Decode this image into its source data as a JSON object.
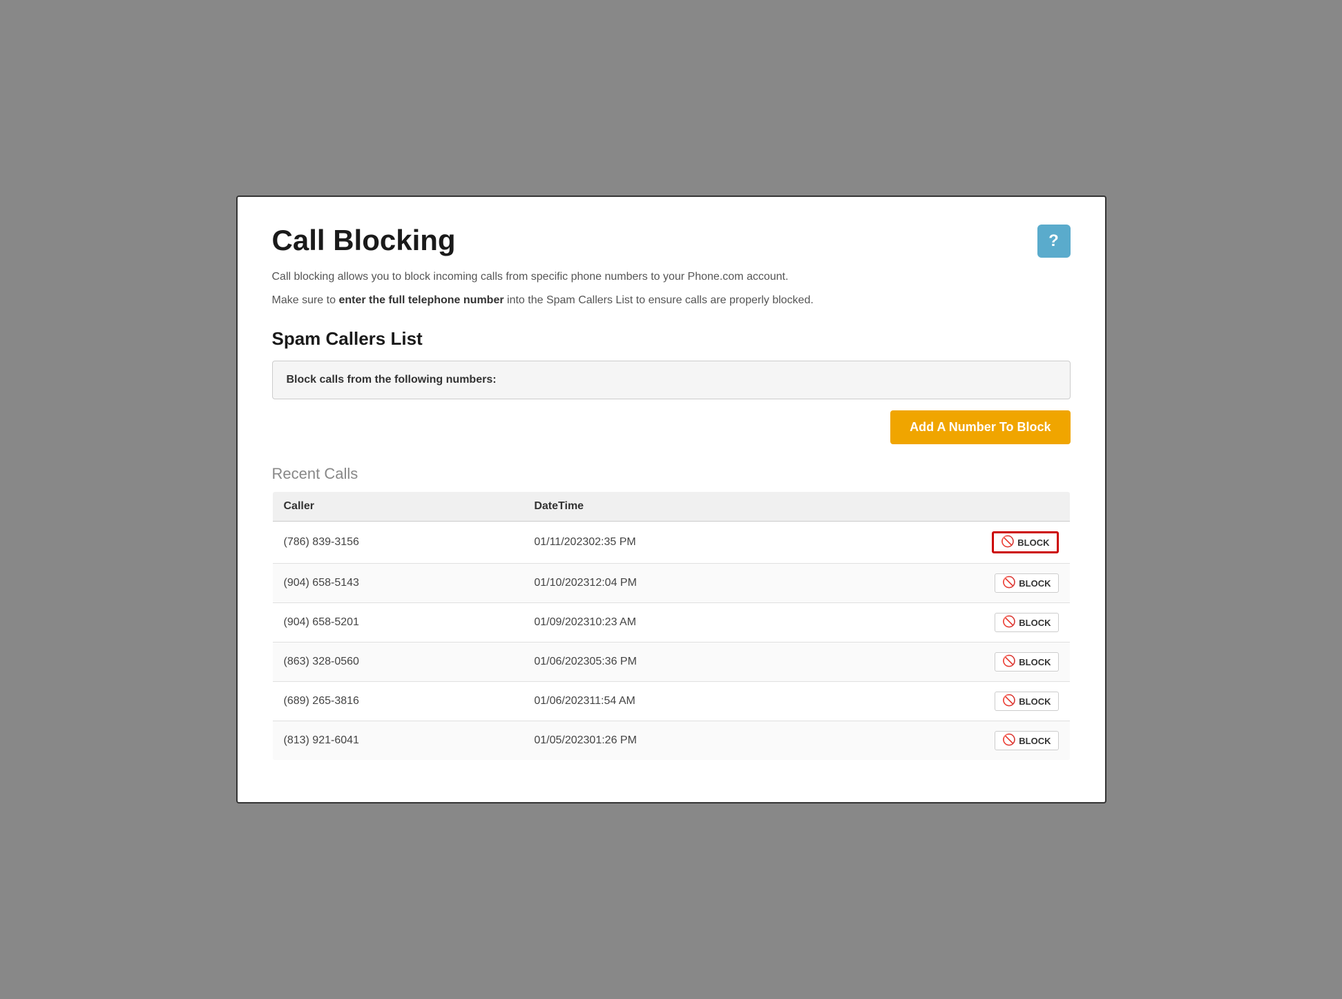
{
  "page": {
    "title": "Call Blocking",
    "help_button_label": "?",
    "description1": "Call blocking allows you to block incoming calls from specific phone numbers to your Phone.com account.",
    "description2_prefix": "Make sure to ",
    "description2_bold": "enter the full telephone number",
    "description2_suffix": " into the Spam Callers List to ensure calls are properly blocked.",
    "spam_callers_title": "Spam Callers List",
    "spam_callers_label": "Block calls from the following numbers:",
    "add_button_label": "Add A Number To Block",
    "recent_calls_title": "Recent Calls",
    "table": {
      "columns": [
        "Caller",
        "DateTime",
        ""
      ],
      "rows": [
        {
          "caller": "(786) 839-3156",
          "datetime": "01/11/202302:35 PM",
          "highlighted": true
        },
        {
          "caller": "(904) 658-5143",
          "datetime": "01/10/202312:04 PM",
          "highlighted": false
        },
        {
          "caller": "(904) 658-5201",
          "datetime": "01/09/202310:23 AM",
          "highlighted": false
        },
        {
          "caller": "(863) 328-0560",
          "datetime": "01/06/202305:36 PM",
          "highlighted": false
        },
        {
          "caller": "(689) 265-3816",
          "datetime": "01/06/202311:54 AM",
          "highlighted": false
        },
        {
          "caller": "(813) 921-6041",
          "datetime": "01/05/202301:26 PM",
          "highlighted": false
        }
      ],
      "block_label": "BLOCK"
    }
  }
}
